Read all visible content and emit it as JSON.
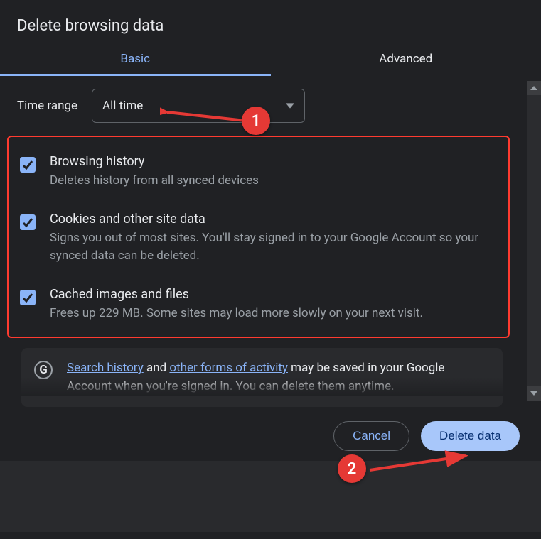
{
  "title": "Delete browsing data",
  "tabs": {
    "basic": "Basic",
    "advanced": "Advanced"
  },
  "timerange": {
    "label": "Time range",
    "value": "All time"
  },
  "options": [
    {
      "title": "Browsing history",
      "desc": "Deletes history from all synced devices"
    },
    {
      "title": "Cookies and other site data",
      "desc": "Signs you out of most sites. You'll stay signed in to your Google Account so your synced data can be deleted."
    },
    {
      "title": "Cached images and files",
      "desc": "Frees up 229 MB. Some sites may load more slowly on your next visit."
    }
  ],
  "info": {
    "logo": "G",
    "link1": "Search history",
    "mid1": " and ",
    "link2": "other forms of activity",
    "rest": " may be saved in your Google Account when you're signed in. You can delete them anytime."
  },
  "buttons": {
    "cancel": "Cancel",
    "confirm": "Delete data"
  },
  "annotations": {
    "badge1": "1",
    "badge2": "2"
  }
}
